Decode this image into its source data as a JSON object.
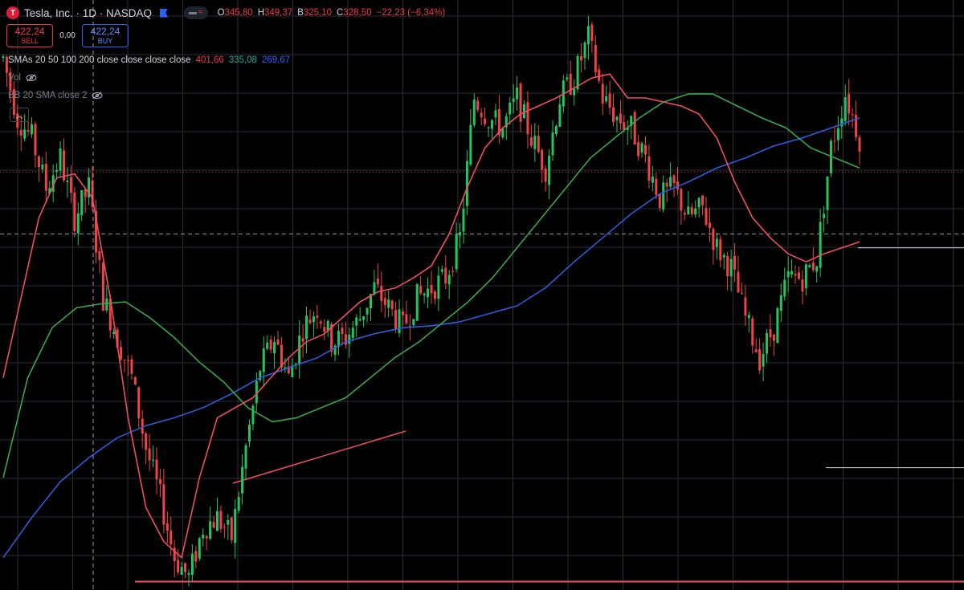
{
  "header": {
    "logo_letter": "T",
    "symbol": "Tesla, Inc. · 1D · NASDAQ",
    "ohlc": [
      {
        "k": "O",
        "v": "345,80"
      },
      {
        "k": "H",
        "v": "349,37"
      },
      {
        "k": "B",
        "v": "325,10"
      },
      {
        "k": "C",
        "v": "328,50"
      },
      {
        "k": "",
        "v": "−22,23 (−6,34%)"
      }
    ]
  },
  "trade": {
    "sell_price": "422,24",
    "sell_label": "SELL",
    "spread": "0,00",
    "buy_price": "422,24",
    "buy_label": "BUY"
  },
  "indicators": {
    "sma_name": "SMAs 20 50 100 200 close close close close",
    "sma_v1": "401,66",
    "sma_v2": "335,08",
    "sma_v3": "269,67",
    "vol_name": "Vol",
    "bb_name": "BB 20 SMA close 2"
  },
  "colors": {
    "up": "#26a69a",
    "down": "#f23645",
    "candle_up": "#22c55e",
    "candle_down": "#ef4444",
    "sma20": "#f04e5e",
    "sma50": "#3aa54a",
    "sma100": "#2f5bd8",
    "grid": "#2a2e39",
    "bg": "#000000"
  },
  "chart_data": {
    "type": "line",
    "x": [
      0,
      4,
      8,
      12,
      16,
      20,
      24,
      28,
      32,
      36,
      40,
      44,
      48,
      52,
      56,
      60,
      64,
      68,
      72,
      76,
      80,
      84,
      88,
      92,
      96,
      100,
      104,
      108,
      112,
      116,
      120,
      124,
      128,
      132,
      136,
      140,
      144,
      148,
      152,
      156,
      160,
      164,
      168,
      172,
      176,
      180,
      184,
      188,
      192,
      196,
      200,
      204,
      208,
      212,
      216,
      220,
      224,
      228,
      232,
      236,
      240
    ],
    "close_series": [
      460,
      430,
      420,
      395,
      410,
      380,
      395,
      340,
      320,
      300,
      265,
      240,
      210,
      200,
      225,
      230,
      220,
      265,
      305,
      320,
      300,
      325,
      335,
      318,
      320,
      330,
      345,
      335,
      325,
      340,
      345,
      350,
      370,
      440,
      430,
      425,
      440,
      420,
      405,
      440,
      450,
      470,
      440,
      430,
      425,
      410,
      390,
      395,
      380,
      385,
      365,
      355,
      330,
      310,
      325,
      350,
      350,
      360,
      415,
      442,
      420
    ],
    "sma20_series": [
      300,
      340,
      380,
      400,
      402,
      390,
      340,
      280,
      235,
      218,
      210,
      250,
      280,
      285,
      290,
      300,
      310,
      318,
      322,
      330,
      338,
      343,
      345,
      350,
      356,
      372,
      395,
      415,
      425,
      432,
      436,
      440,
      445,
      450,
      452,
      440,
      440,
      438,
      436,
      432,
      420,
      398,
      380,
      370,
      362,
      358,
      362,
      365,
      368
    ],
    "sma50_series": [
      250,
      300,
      325,
      335,
      337,
      338,
      330,
      320,
      308,
      298,
      285,
      278,
      280,
      285,
      290,
      300,
      310,
      318,
      328,
      338,
      350,
      365,
      380,
      395,
      410,
      420,
      430,
      438,
      442,
      442,
      436,
      430,
      425,
      415,
      410,
      405
    ],
    "sma100_series": [
      210,
      230,
      248,
      260,
      270,
      276,
      280,
      285,
      292,
      300,
      305,
      310,
      318,
      322,
      325,
      326,
      328,
      332,
      336,
      345,
      358,
      370,
      382,
      392,
      398,
      405,
      410,
      416,
      420,
      425,
      430
    ],
    "levels": [
      {
        "name": "support",
        "value": 198
      },
      {
        "name": "current",
        "value": 403
      },
      {
        "name": "mid",
        "value": 372
      },
      {
        "name": "ref1",
        "value": 365
      },
      {
        "name": "ref2",
        "value": 255
      }
    ],
    "title": "",
    "xlabel": "",
    "ylabel": "",
    "ylim": [
      195,
      485
    ],
    "grid": true,
    "legend": "top-left"
  }
}
